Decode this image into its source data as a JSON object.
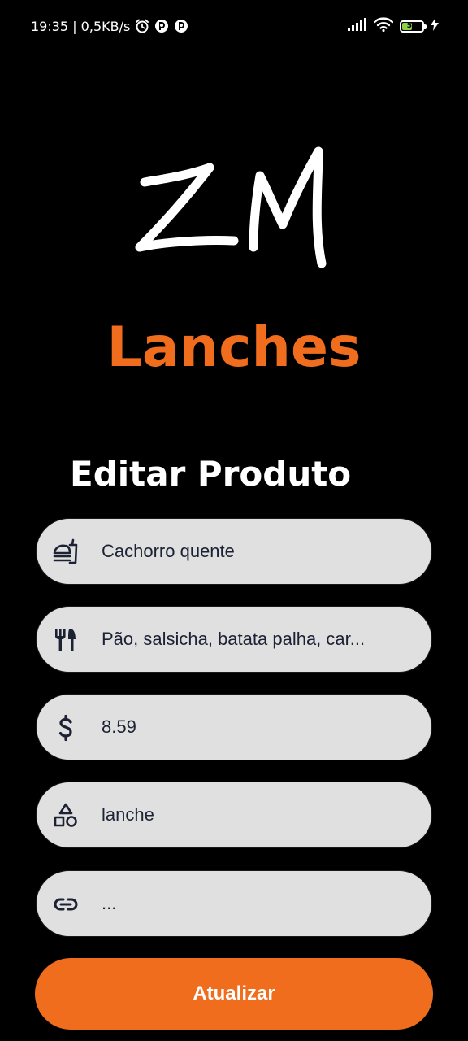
{
  "status_bar": {
    "time_speed": "19:35 | 0,5KB/s",
    "battery_level": "50",
    "battery_fraction": 0.5,
    "icons": [
      "alarm-icon",
      "notification-app-icon",
      "notification-app-icon",
      "signal-icon",
      "wifi-icon",
      "battery-icon",
      "charging-icon"
    ]
  },
  "brand": {
    "logo_text": "ZM",
    "name": "Lanches",
    "accent_color": "#f06d1e"
  },
  "page": {
    "title": "Editar Produto"
  },
  "form": {
    "fields": [
      {
        "icon": "food-tray-icon",
        "value": "Cachorro quente"
      },
      {
        "icon": "utensils-icon",
        "value": "Pão, salsicha, batata palha, car..."
      },
      {
        "icon": "dollar-icon",
        "value": "8.59"
      },
      {
        "icon": "category-shapes-icon",
        "value": "lanche"
      },
      {
        "icon": "link-icon",
        "value": "..."
      }
    ],
    "submit_label": "Atualizar"
  }
}
